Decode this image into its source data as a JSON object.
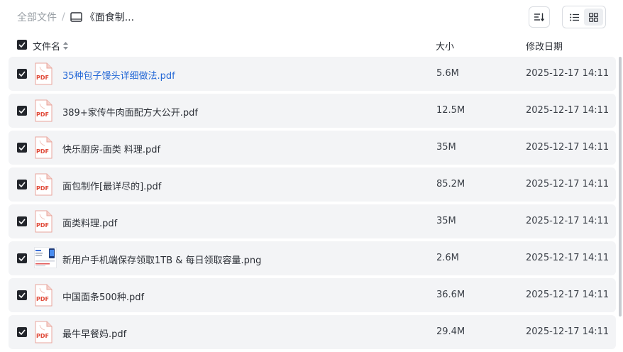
{
  "breadcrumb": {
    "root": "全部文件",
    "separator": "/",
    "current": "《面食制..."
  },
  "toolbar": {
    "sort_icon": "sort-icon",
    "list_view_icon": "list-view-icon",
    "grid_view_icon": "grid-view-icon"
  },
  "columns": {
    "name": "文件名",
    "size": "大小",
    "modified": "修改日期"
  },
  "files": [
    {
      "name": "35种包子馒头详细做法.pdf",
      "size": "5.6M",
      "date": "2025-12-17 14:11",
      "type": "pdf",
      "highlighted": true
    },
    {
      "name": "389+家传牛肉面配方大公开.pdf",
      "size": "12.5M",
      "date": "2025-12-17 14:11",
      "type": "pdf"
    },
    {
      "name": "快乐厨房-面类 料理.pdf",
      "size": "35M",
      "date": "2025-12-17 14:11",
      "type": "pdf"
    },
    {
      "name": "面包制作[最详尽的].pdf",
      "size": "85.2M",
      "date": "2025-12-17 14:11",
      "type": "pdf"
    },
    {
      "name": "面类料理.pdf",
      "size": "35M",
      "date": "2025-12-17 14:11",
      "type": "pdf"
    },
    {
      "name": "新用户手机端保存领取1TB & 每日领取容量.png",
      "size": "2.6M",
      "date": "2025-12-17 14:11",
      "type": "png"
    },
    {
      "name": "中国面条500种.pdf",
      "size": "36.6M",
      "date": "2025-12-17 14:11",
      "type": "pdf"
    },
    {
      "name": "最牛早餐妈.pdf",
      "size": "29.4M",
      "date": "2025-12-17 14:11",
      "type": "pdf"
    }
  ],
  "pdf_label": "PDF",
  "colors": {
    "link": "#2468d6",
    "pdf_red": "#e04b3a",
    "row_bg": "#f3f4f6",
    "checkbox": "#22252b"
  }
}
